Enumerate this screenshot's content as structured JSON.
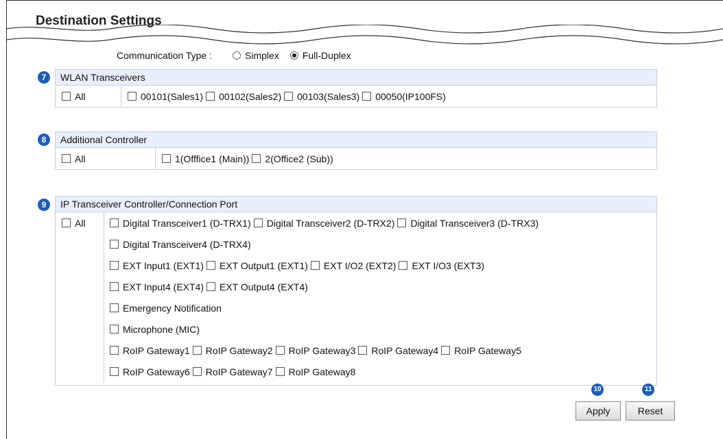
{
  "page": {
    "title": "Destination Settings"
  },
  "communication_type": {
    "label": "Communication Type :",
    "options": [
      {
        "label": "Simplex",
        "selected": false
      },
      {
        "label": "Full-Duplex",
        "selected": true
      }
    ]
  },
  "wlan": {
    "badge": "7",
    "title": "WLAN Transceivers",
    "all_label": "All",
    "items": [
      "00101(Sales1)",
      "00102(Sales2)",
      "00103(Sales3)",
      "00050(IP100FS)"
    ]
  },
  "controller": {
    "badge": "8",
    "title": "Additional Controller",
    "all_label": "All",
    "items": [
      "1(Offfice1 (Main))",
      "2(Office2 (Sub))"
    ]
  },
  "ip": {
    "badge": "9",
    "title": "IP Transceiver Controller/Connection Port",
    "all_label": "All",
    "items": [
      "Digital Transceiver1 (D-TRX1)",
      "Digital Transceiver2 (D-TRX2)",
      "Digital Transceiver3 (D-TRX3)",
      "Digital Transceiver4 (D-TRX4)",
      "EXT Input1 (EXT1)",
      "EXT Output1 (EXT1)",
      "EXT I/O2 (EXT2)",
      "EXT I/O3 (EXT3)",
      "EXT Input4 (EXT4)",
      "EXT Output4 (EXT4)",
      "Emergency Notification",
      "Microphone (MIC)",
      "RoIP Gateway1",
      "RoIP Gateway2",
      "RoIP Gateway3",
      "RoIP Gateway4",
      "RoIP Gateway5",
      "RoIP Gateway6",
      "RoIP Gateway7",
      "RoIP Gateway8"
    ]
  },
  "buttons": {
    "apply_badge": "10",
    "apply_label": "Apply",
    "reset_badge": "11",
    "reset_label": "Reset"
  }
}
